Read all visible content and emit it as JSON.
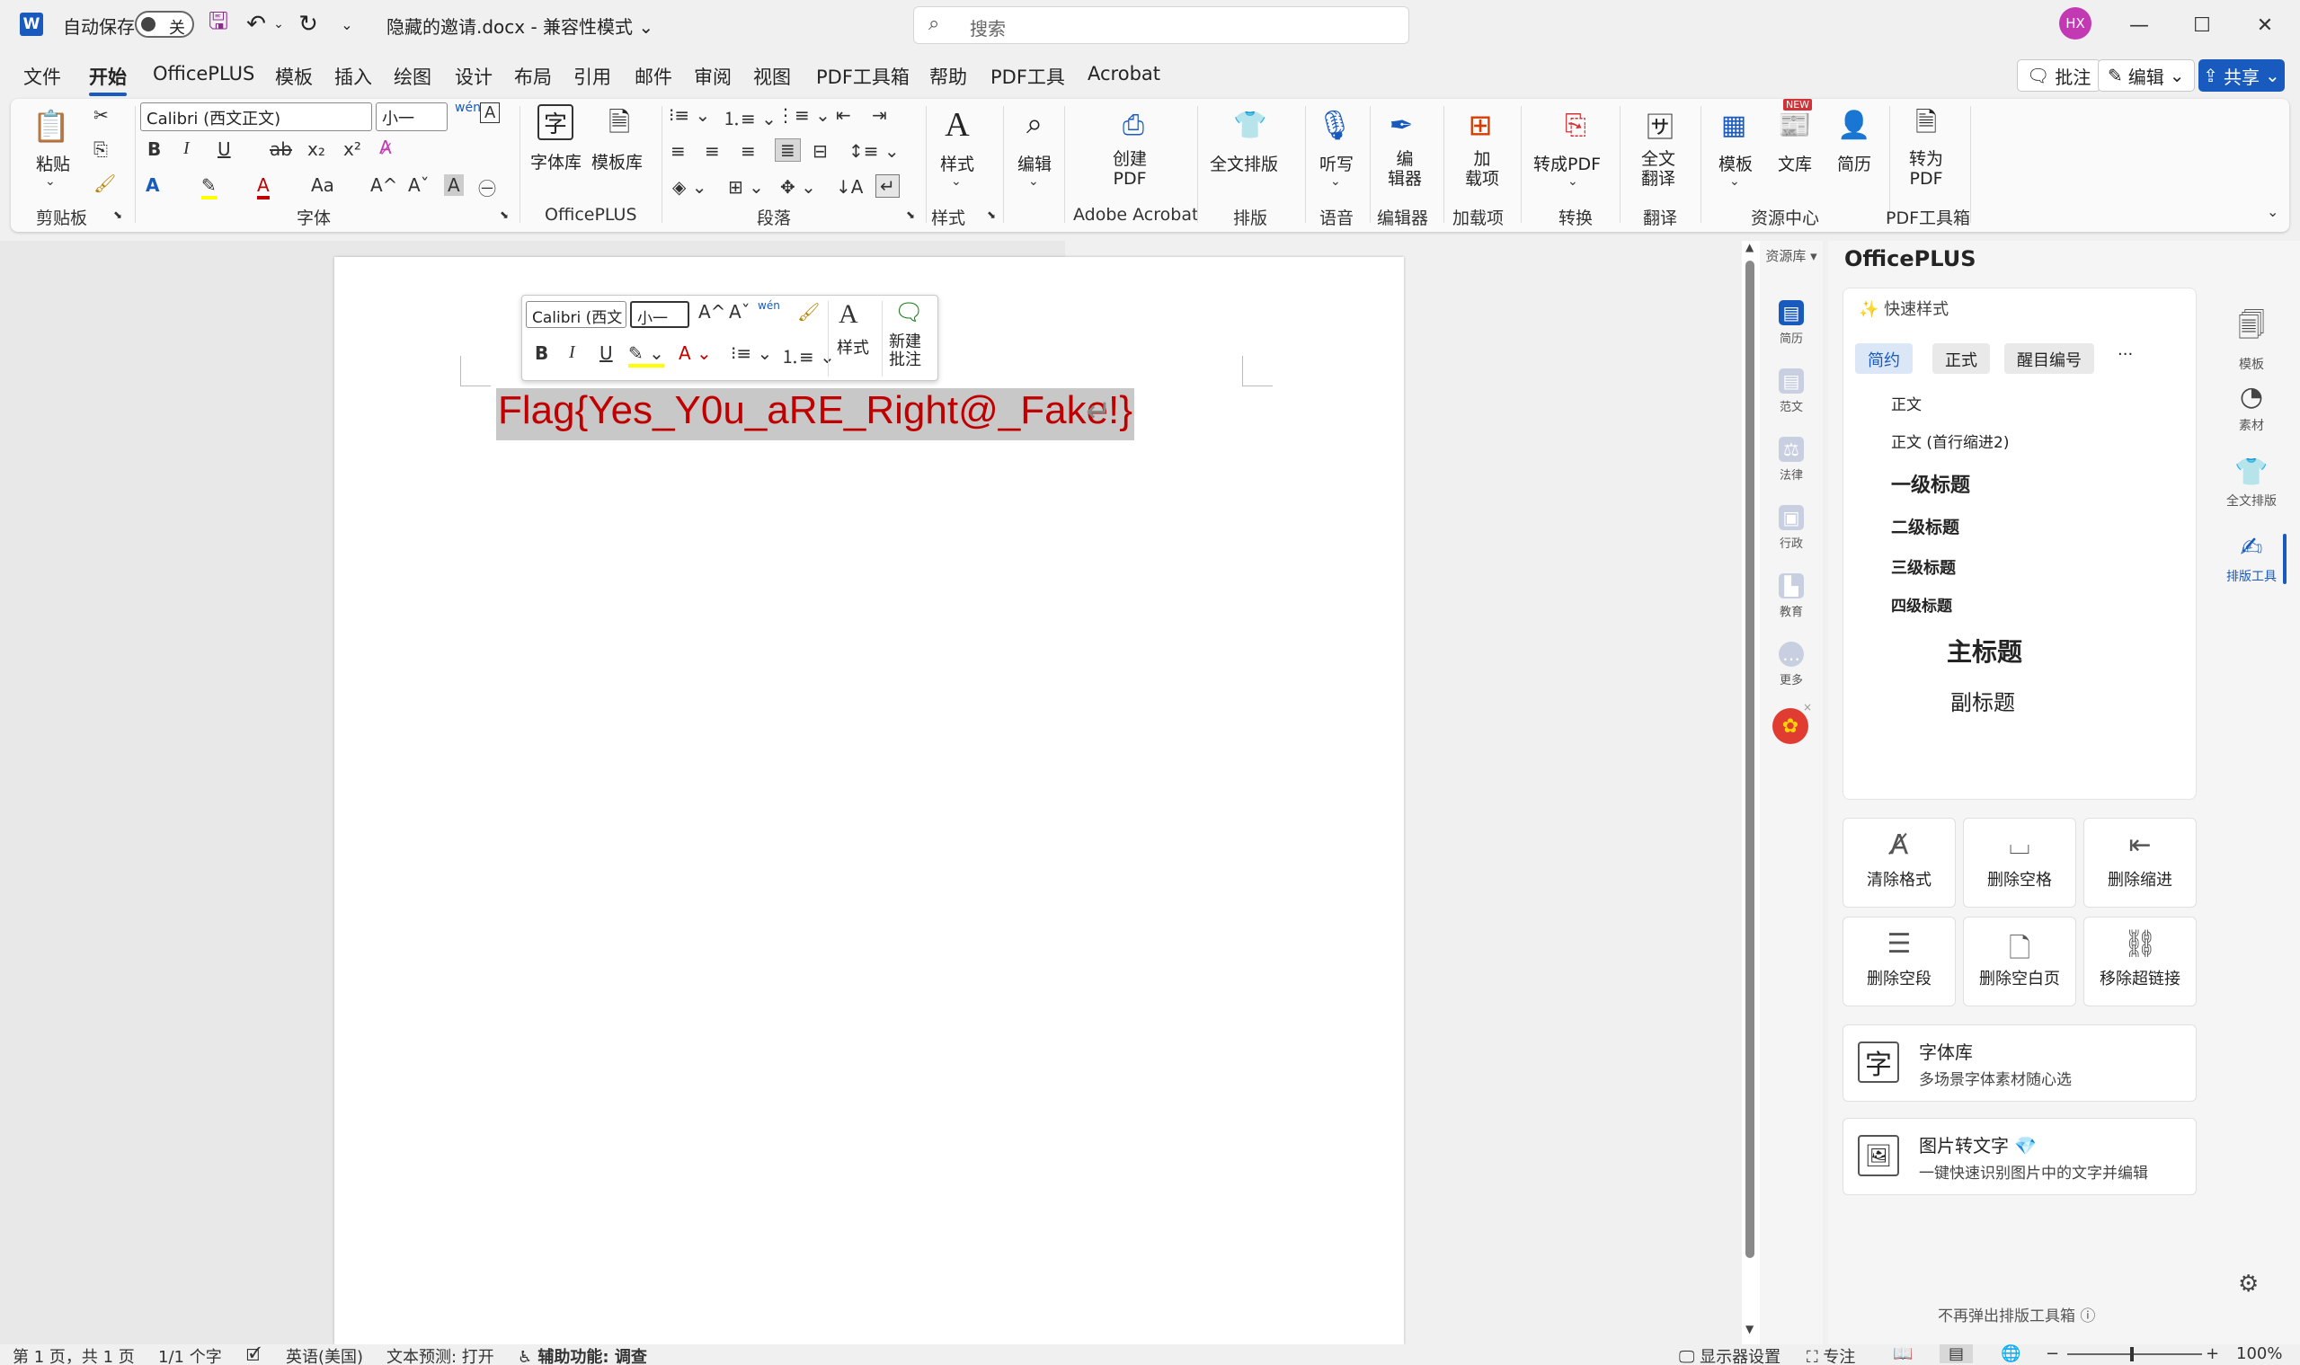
{
  "titlebar": {
    "autosave_label": "自动保存",
    "autosave_state": "关",
    "doc_title": "隐藏的邀请.docx  -  兼容性模式",
    "search_placeholder": "搜索",
    "avatar_initials": "HX"
  },
  "menu": {
    "tabs": [
      "文件",
      "开始",
      "OfficePLUS",
      "模板",
      "插入",
      "绘图",
      "设计",
      "布局",
      "引用",
      "邮件",
      "审阅",
      "视图",
      "PDF工具箱",
      "帮助",
      "PDF工具",
      "Acrobat"
    ],
    "active": "开始",
    "comment_btn": "批注",
    "edit_btn": "编辑",
    "share_btn": "共享"
  },
  "ribbon": {
    "paste": "粘贴",
    "font_name": "Calibri (西文正文)",
    "font_size": "小一",
    "font_lib": "字体库",
    "template_lib": "模板库",
    "styles": "样式",
    "editing": "编辑",
    "create_pdf": "创建\nPDF",
    "full_layout": "全文排版",
    "dictate": "听写",
    "editor": "编\n辑器",
    "addins": "加\n载项",
    "to_pdf": "转成PDF",
    "translate": "全文\n翻译",
    "template": "模板",
    "library": "文库",
    "resume": "简历",
    "convert_pdf": "转为\nPDF",
    "new_badge": "NEW",
    "groups": {
      "clipboard": "剪贴板",
      "font": "字体",
      "officeplus": "OfficePLUS",
      "paragraph": "段落",
      "styles": "样式",
      "adobe": "Adobe Acrobat",
      "layout": "排版",
      "voice": "语音",
      "editor": "编辑器",
      "addins": "加载项",
      "convert": "转换",
      "translate": "翻译",
      "resources": "资源中心",
      "pdf_tools": "PDF工具箱"
    }
  },
  "document": {
    "text": "Flag{Yes_Y0u_aRE_Right@_Fake!}",
    "para_mark": "↵"
  },
  "mini_toolbar": {
    "font": "Calibri (西文",
    "size": "小一",
    "styles": "样式",
    "new_comment": "新建\n批注"
  },
  "resource_strip": {
    "header": "资源库",
    "items": [
      "简历",
      "范文",
      "法律",
      "行政",
      "教育",
      "更多"
    ]
  },
  "panel": {
    "title": "OfficePLUS",
    "quick_styles": "快速样式",
    "tabs": [
      "简约",
      "正式",
      "醒目编号"
    ],
    "more": "···",
    "styles": [
      "正文",
      "正文 (首行缩进2)",
      "一级标题",
      "二级标题",
      "三级标题",
      "四级标题",
      "主标题",
      "副标题"
    ],
    "tools": [
      "清除格式",
      "删除空格",
      "删除缩进",
      "删除空段",
      "删除空白页",
      "移除超链接"
    ],
    "promos": [
      {
        "title": "字体库",
        "sub": "多场景字体素材随心选"
      },
      {
        "title": "图片转文字",
        "sub": "一键快速识别图片中的文字并编辑"
      }
    ],
    "footer": "不再弹出排版工具箱"
  },
  "rail": {
    "items": [
      "模板",
      "素材",
      "全文排版",
      "排版工具"
    ],
    "active": "排版工具"
  },
  "statusbar": {
    "page": "第 1 页，共 1 页",
    "words": "1/1 个字",
    "language": "英语(美国)",
    "prediction": "文本预测: 打开",
    "accessibility": "辅助功能: 调查",
    "display": "显示器设置",
    "focus": "专注",
    "zoom": "100%"
  },
  "colors": {
    "accent": "#185abd",
    "flag_text": "#c00000",
    "avatar": "#c239b3"
  }
}
